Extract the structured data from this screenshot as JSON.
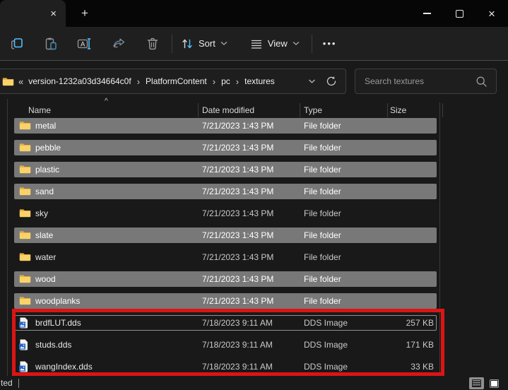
{
  "icons": {
    "tab_close": "×",
    "new_tab": "+",
    "window_close": "×",
    "breadcrumb_overflow": "«",
    "breadcrumb_separator": "›",
    "more_options": "•••",
    "sort_caret": "^"
  },
  "toolbar": {
    "sort_label": "Sort",
    "view_label": "View"
  },
  "address": {
    "breadcrumbs": [
      "version-1232a03d34664c0f",
      "PlatformContent",
      "pc",
      "textures"
    ]
  },
  "search": {
    "placeholder": "Search textures"
  },
  "files": {
    "columns": [
      "Name",
      "Date modified",
      "Type",
      "Size"
    ],
    "sort": {
      "column": "Name",
      "direction": "ascending"
    },
    "rows": [
      {
        "name": "metal",
        "date": "7/21/2023 1:43 PM",
        "type": "File folder",
        "size": "",
        "icon": "folder",
        "selected": true,
        "focused": false
      },
      {
        "name": "pebble",
        "date": "7/21/2023 1:43 PM",
        "type": "File folder",
        "size": "",
        "icon": "folder",
        "selected": true,
        "focused": false
      },
      {
        "name": "plastic",
        "date": "7/21/2023 1:43 PM",
        "type": "File folder",
        "size": "",
        "icon": "folder",
        "selected": true,
        "focused": false
      },
      {
        "name": "sand",
        "date": "7/21/2023 1:43 PM",
        "type": "File folder",
        "size": "",
        "icon": "folder",
        "selected": true,
        "focused": false
      },
      {
        "name": "sky",
        "date": "7/21/2023 1:43 PM",
        "type": "File folder",
        "size": "",
        "icon": "folder",
        "selected": false,
        "focused": false
      },
      {
        "name": "slate",
        "date": "7/21/2023 1:43 PM",
        "type": "File folder",
        "size": "",
        "icon": "folder",
        "selected": true,
        "focused": false
      },
      {
        "name": "water",
        "date": "7/21/2023 1:43 PM",
        "type": "File folder",
        "size": "",
        "icon": "folder",
        "selected": false,
        "focused": false
      },
      {
        "name": "wood",
        "date": "7/21/2023 1:43 PM",
        "type": "File folder",
        "size": "",
        "icon": "folder",
        "selected": true,
        "focused": false
      },
      {
        "name": "woodplanks",
        "date": "7/21/2023 1:43 PM",
        "type": "File folder",
        "size": "",
        "icon": "folder",
        "selected": true,
        "focused": false
      },
      {
        "name": "brdfLUT.dds",
        "date": "7/18/2023 9:11 AM",
        "type": "DDS Image",
        "size": "257 KB",
        "icon": "dds-image",
        "selected": false,
        "focused": true
      },
      {
        "name": "studs.dds",
        "date": "7/18/2023 9:11 AM",
        "type": "DDS Image",
        "size": "171 KB",
        "icon": "dds-image",
        "selected": false,
        "focused": false
      },
      {
        "name": "wangIndex.dds",
        "date": "7/18/2023 9:11 AM",
        "type": "DDS Image",
        "size": "33 KB",
        "icon": "dds-image",
        "selected": false,
        "focused": false
      }
    ]
  },
  "status_bar": {
    "left_text": "ted"
  },
  "annotation": {
    "shape": "rectangle",
    "purpose": "highlights the three DDS image files",
    "color": "#dc1414"
  },
  "colors": {
    "accent_blue": "#4cc2ff",
    "selection_gray": "#787878",
    "folder_yellow": "#f9d269",
    "background": "#191919",
    "annotation_red": "#dc1414"
  }
}
